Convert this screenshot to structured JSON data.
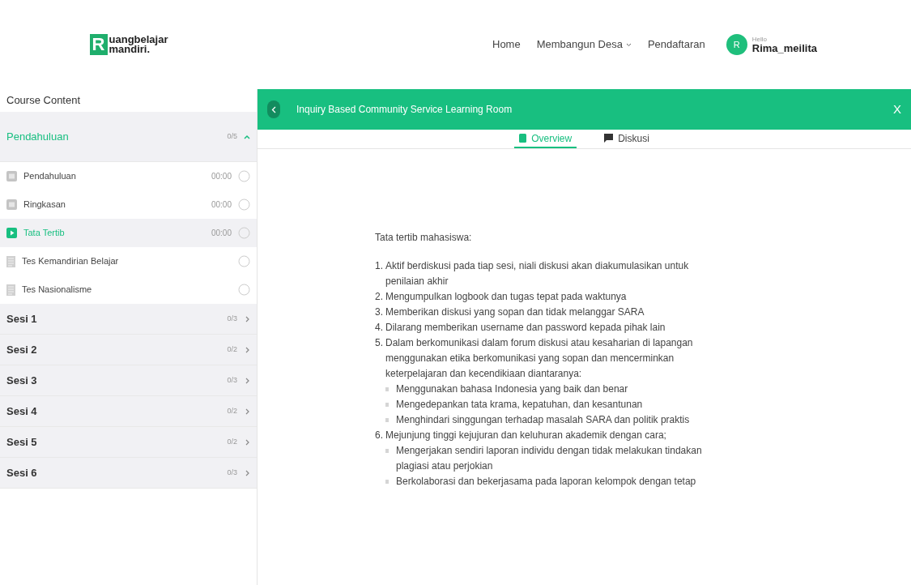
{
  "header": {
    "logo": {
      "letter": "R",
      "line1": "uangbelajar",
      "line2": "mandiri."
    },
    "nav": [
      {
        "label": "Home",
        "kind": "link"
      },
      {
        "label": "Membangun Desa",
        "kind": "dropdown"
      },
      {
        "label": "Pendaftaran",
        "kind": "link"
      }
    ],
    "user": {
      "avatar_letter": "R",
      "greeting": "Hello",
      "name": "Rima_meilita"
    }
  },
  "sidebar": {
    "title": "Course Content",
    "sections": [
      {
        "title": "Pendahuluan",
        "progress": "0/5",
        "expanded": true,
        "items": [
          {
            "label": "Pendahuluan",
            "duration": "00:00",
            "kind": "video",
            "selected": false
          },
          {
            "label": "Ringkasan",
            "duration": "00:00",
            "kind": "video",
            "selected": false
          },
          {
            "label": "Tata Tertib",
            "duration": "00:00",
            "kind": "video",
            "selected": true
          },
          {
            "label": "Tes Kemandirian Belajar",
            "kind": "test",
            "selected": false
          },
          {
            "label": "Tes Nasionalisme",
            "kind": "test",
            "selected": false
          }
        ]
      },
      {
        "title": "Sesi 1",
        "progress": "0/3",
        "expanded": false
      },
      {
        "title": "Sesi 2",
        "progress": "0/2",
        "expanded": false
      },
      {
        "title": "Sesi 3",
        "progress": "0/3",
        "expanded": false
      },
      {
        "title": "Sesi 4",
        "progress": "0/2",
        "expanded": false
      },
      {
        "title": "Sesi 5",
        "progress": "0/2",
        "expanded": false
      },
      {
        "title": "Sesi 6",
        "progress": "0/3",
        "expanded": false
      }
    ]
  },
  "course_bar": {
    "title": "Inquiry Based Community Service Learning Room",
    "close": "X"
  },
  "tabs": [
    {
      "label": "Overview",
      "kind": "overview",
      "selected": true
    },
    {
      "label": "Diskusi",
      "kind": "discussion",
      "selected": false
    }
  ],
  "content": {
    "heading": "Tata tertib mahasiswa:",
    "rules": [
      {
        "number": "1.",
        "text": "Aktif berdiskusi pada tiap sesi, niali diskusi akan diakumulasikan untuk penilaian akhir"
      },
      {
        "number": "2.",
        "text": "Mengumpulkan logbook dan tugas tepat pada waktunya"
      },
      {
        "number": "3.",
        "text": "Memberikan diskusi yang sopan dan tidak melanggar SARA"
      },
      {
        "number": "4.",
        "text": "Dilarang memberikan username dan password kepada pihak lain"
      },
      {
        "number": "5.",
        "text": "Dalam berkomunikasi dalam forum diskusi atau kesaharian di lapangan menggunakan etika berkomunikasi yang sopan dan mencerminkan keterpelajaran dan kecendikiaan diantaranya:",
        "children": [
          "Menggunakan bahasa Indonesia yang baik dan benar",
          "Mengedepankan tata krama, kepatuhan, dan kesantunan",
          "Menghindari singgungan terhadap masalah SARA dan politik praktis"
        ]
      },
      {
        "number": "6.",
        "text": "Mejunjung tinggi kejujuran dan keluhuran akademik dengan cara;",
        "children": [
          "Mengerjakan sendiri laporan individu dengan tidak melakukan tindakan plagiasi atau perjokian",
          "Berkolaborasi dan bekerjasama pada laporan kelompok dengan tetap"
        ]
      }
    ]
  }
}
